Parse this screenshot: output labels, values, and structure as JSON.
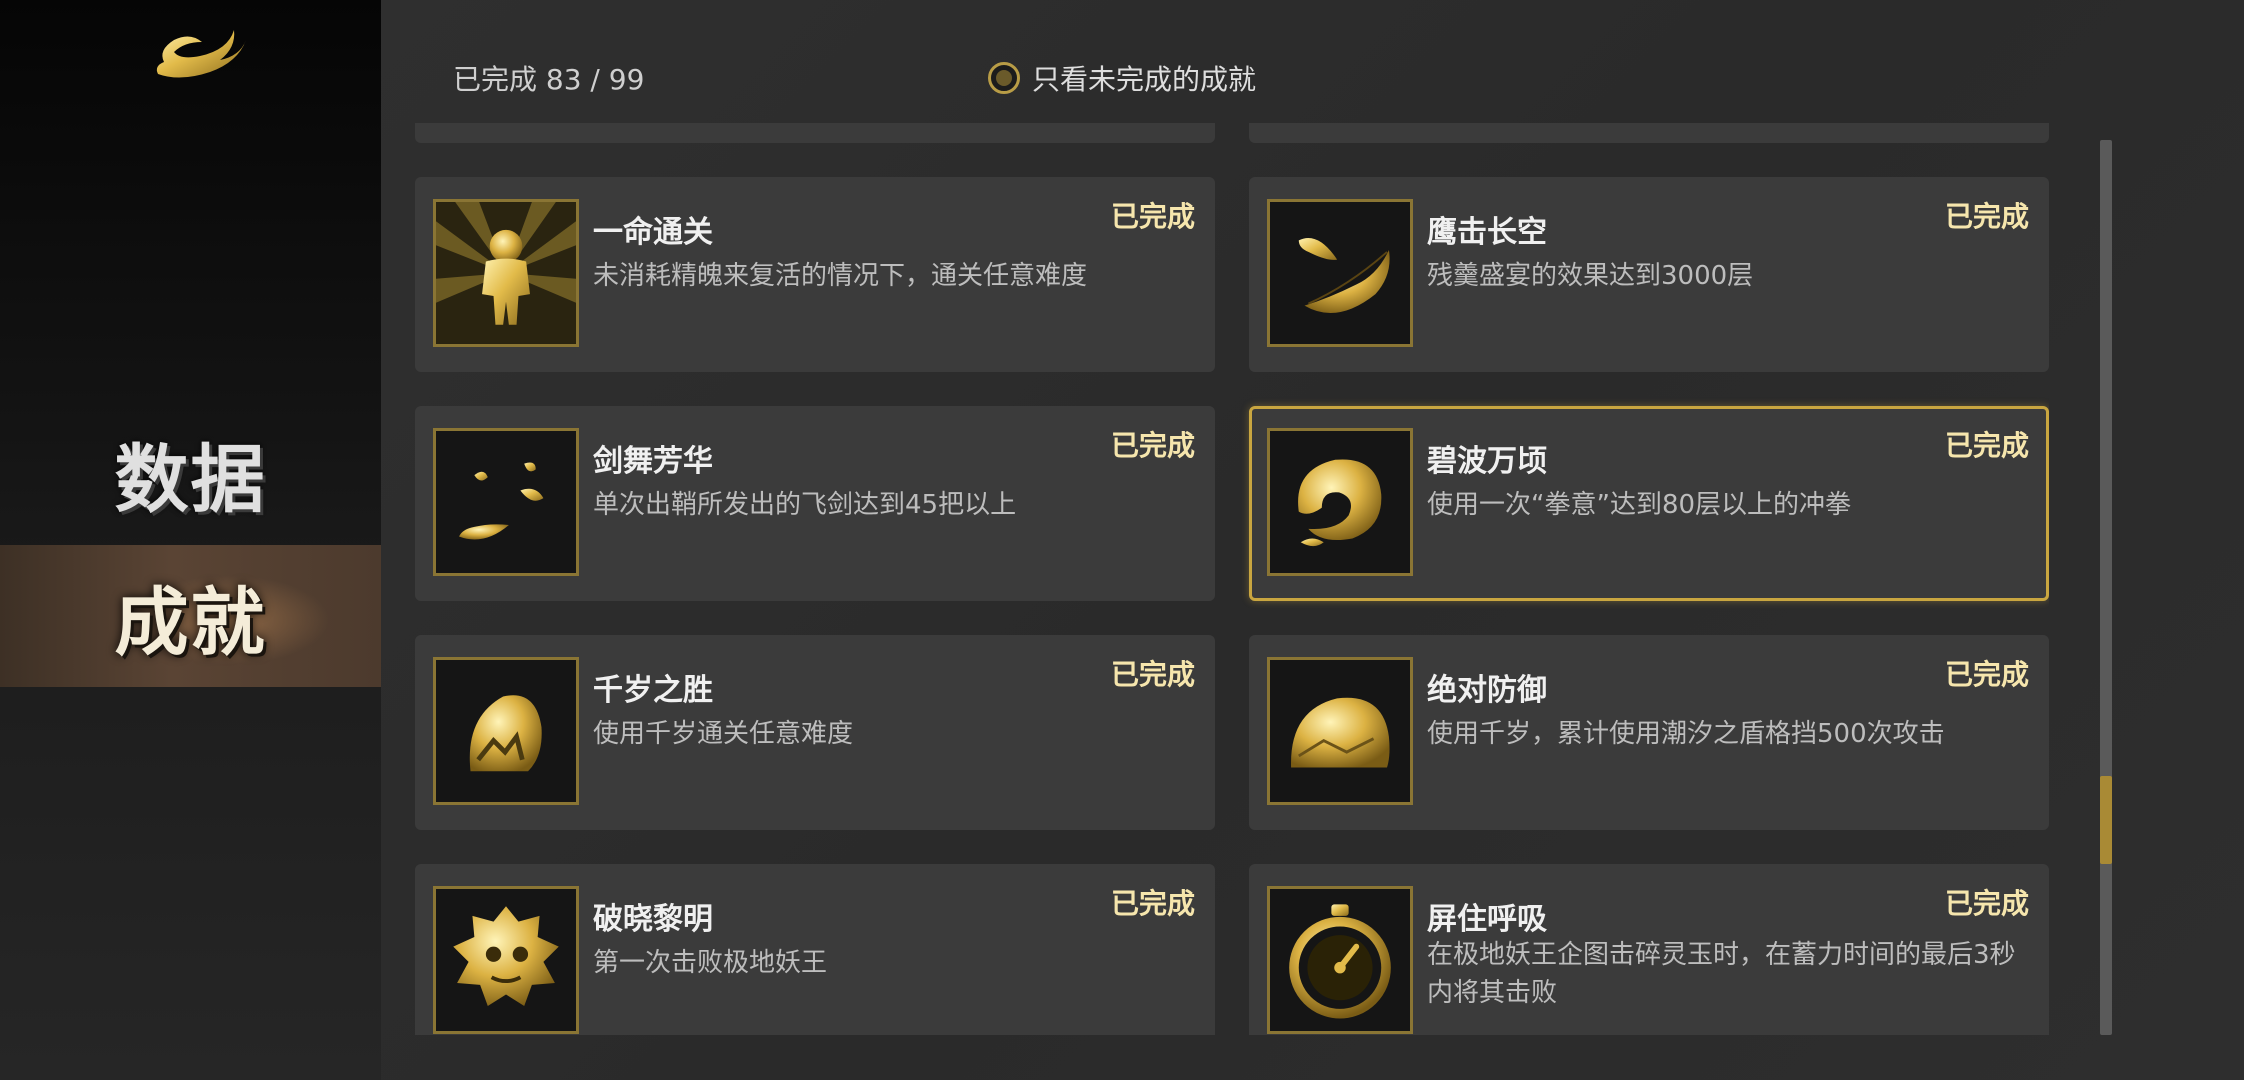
{
  "sidebar": {
    "items": [
      {
        "label": "数据"
      },
      {
        "label": "成就"
      }
    ]
  },
  "header": {
    "progress": "已完成 83 / 99",
    "filter_label": "只看未完成的成就"
  },
  "colors": {
    "gold": "#c9a640",
    "status": "#f6e6ad",
    "card": "#3b3b3b"
  },
  "achievements": [
    {
      "title": "一命通关",
      "desc": "未消耗精魄来复活的情况下，通关任意难度",
      "status": "已完成",
      "icon": "figure-icon"
    },
    {
      "title": "鹰击长空",
      "desc": "残羹盛宴的效果达到3000层",
      "status": "已完成",
      "icon": "feather-icon"
    },
    {
      "title": "剑舞芳华",
      "desc": "单次出鞘所发出的飞剑达到45把以上",
      "status": "已完成",
      "icon": "petals-icon"
    },
    {
      "title": "碧波万顷",
      "desc": "使用一次“拳意”达到80层以上的冲拳",
      "status": "已完成",
      "icon": "wave-icon"
    },
    {
      "title": "千岁之胜",
      "desc": "使用千岁通关任意难度",
      "status": "已完成",
      "icon": "shell-icon"
    },
    {
      "title": "绝对防御",
      "desc": "使用千岁，累计使用潮汐之盾格挡500次攻击",
      "status": "已完成",
      "icon": "shield-rock-icon"
    },
    {
      "title": "破晓黎明",
      "desc": "第一次击败极地妖王",
      "status": "已完成",
      "icon": "demon-mask-icon"
    },
    {
      "title": "屏住呼吸",
      "desc": "在极地妖王企图击碎灵玉时，在蓄力时间的最后3秒内将其击败",
      "status": "已完成",
      "icon": "stopwatch-icon"
    }
  ]
}
